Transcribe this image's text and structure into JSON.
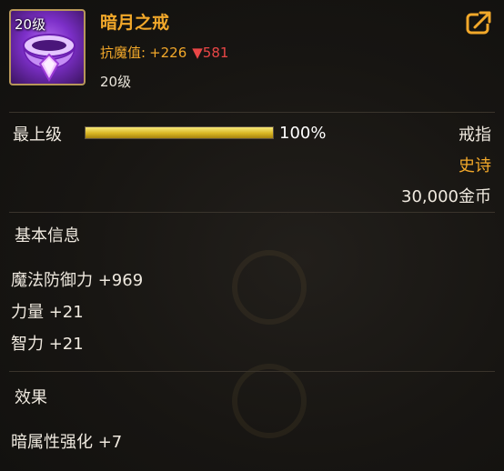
{
  "item": {
    "level_badge": "20级",
    "name": "暗月之戒",
    "stat_label": "抗魔值:",
    "stat_plus": "+226",
    "stat_down": "▼581",
    "level_text": "20级"
  },
  "upgrade": {
    "label": "最上级",
    "progress_percent": 100,
    "percent_text": "100%"
  },
  "meta": {
    "type": "戒指",
    "rarity": "史诗",
    "price": "30,000金币"
  },
  "basic_info": {
    "title": "基本信息",
    "attributes": [
      "魔法防御力 +969",
      "力量 +21",
      "智力 +21"
    ]
  },
  "effects": {
    "title": "效果",
    "items": [
      "暗属性强化 +7"
    ]
  },
  "colors": {
    "accent": "#f2a82a",
    "down": "#e84646",
    "icon_bg": "#7c2fc8"
  },
  "icons": {
    "share": "share-icon",
    "item": "ring-icon"
  }
}
